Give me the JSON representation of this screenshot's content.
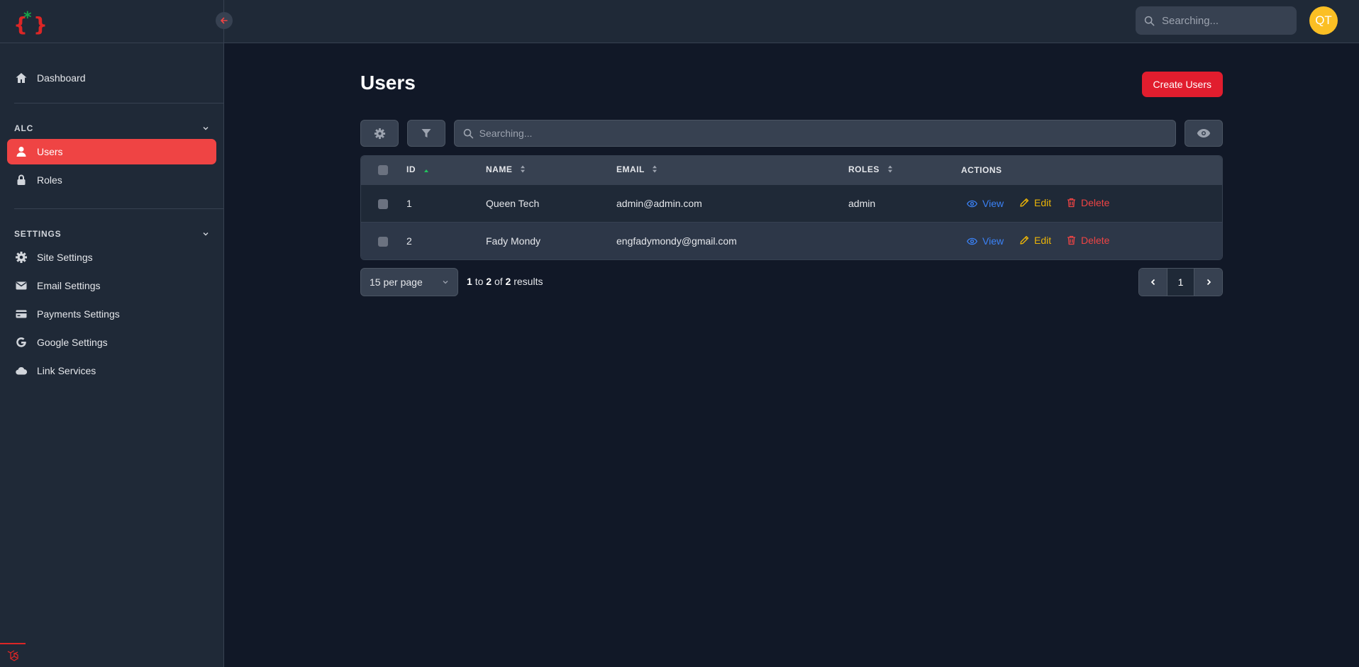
{
  "sidebar": {
    "dashboard": "Dashboard",
    "groups": [
      {
        "title": "ALC",
        "items": [
          "Users",
          "Roles"
        ]
      },
      {
        "title": "SETTINGS",
        "items": [
          "Site Settings",
          "Email Settings",
          "Payments Settings",
          "Google Settings",
          "Link Services"
        ]
      }
    ]
  },
  "topbar": {
    "search_placeholder": "Searching...",
    "avatar_initials": "QT"
  },
  "page": {
    "title": "Users",
    "create_label": "Create Users",
    "search_placeholder": "Searching..."
  },
  "table": {
    "columns": [
      "ID",
      "NAME",
      "EMAIL",
      "ROLES",
      "ACTIONS"
    ],
    "rows": [
      {
        "id": "1",
        "name": "Queen Tech",
        "email": "admin@admin.com",
        "roles": "admin"
      },
      {
        "id": "2",
        "name": "Fady Mondy",
        "email": "engfadymondy@gmail.com",
        "roles": ""
      }
    ],
    "actions": {
      "view": "View",
      "edit": "Edit",
      "delete": "Delete"
    }
  },
  "footer": {
    "per_page": "15 per page",
    "results": {
      "from": "1",
      "to_word": "to",
      "to": "2",
      "of_word": "of",
      "total": "2",
      "results_word": "results"
    },
    "current_page": "1"
  },
  "colors": {
    "accent": "#ef4444",
    "create_button": "#e11d2e",
    "avatar": "#fbbf24",
    "view": "#3b82f6",
    "edit": "#eab308",
    "delete": "#ef4444",
    "logo_star": "#16a34a"
  }
}
